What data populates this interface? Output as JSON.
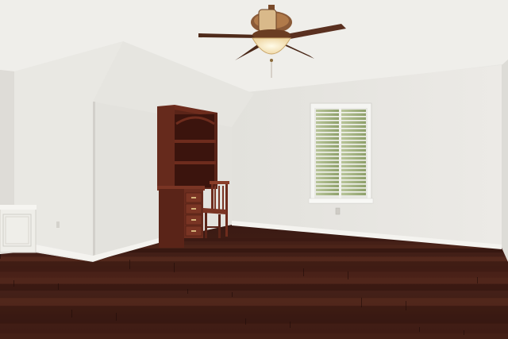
{
  "scene": {
    "subject": "empty-room-photo"
  },
  "colors": {
    "wall": "#ecebe7",
    "wall_shadow": "#dcdad5",
    "ceiling": "#eeede9",
    "floor_dark": "#2f1510",
    "floor_mid": "#4a2219",
    "floor_light": "#6b3527",
    "wood": "#5a2418",
    "wood_light": "#7a3524",
    "window_frame": "#f5f5f2",
    "shutter_green": "#9fae7a",
    "fan_blade": "#5a3020",
    "fan_light": "#f4e6c4",
    "trim": "#f4f3ef"
  },
  "objects": {
    "ceiling_fan": "ceiling-fan",
    "hutch": "wooden-hutch-desk",
    "chair": "wooden-chair",
    "window": "plantation-shutter-window",
    "outlet": "wall-outlet",
    "cabinet": "white-built-in-cabinet",
    "floor": "dark-hardwood-floor"
  }
}
